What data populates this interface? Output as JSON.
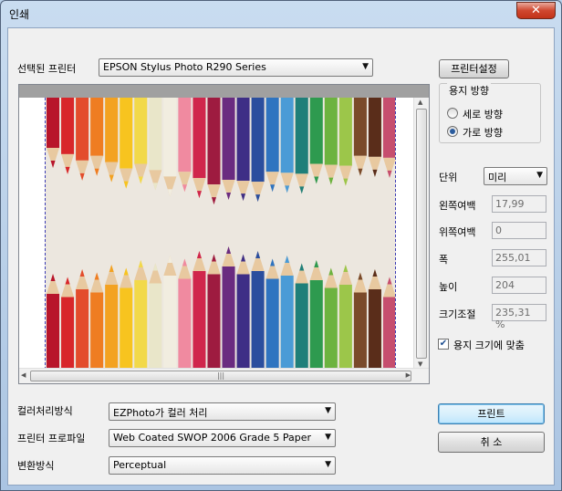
{
  "window": {
    "title": "인쇄",
    "close_glyph": "✕"
  },
  "printer": {
    "label": "선택된 프린터",
    "selected": "EPSON Stylus Photo R290 Series",
    "settings_button": "프린터설정"
  },
  "orientation": {
    "group_label": "용지 방향",
    "portrait": "세로 방향",
    "landscape": "가로 방향",
    "selected": "landscape"
  },
  "unit": {
    "label": "단위",
    "selected": "미리"
  },
  "margins": {
    "left_label": "왼쪽여백",
    "left_value": "17,99",
    "top_label": "위쪽여백",
    "top_value": "0",
    "width_label": "폭",
    "width_value": "255,01",
    "height_label": "높이",
    "height_value": "204",
    "scale_label": "크기조절",
    "scale_value": "235,31 %"
  },
  "fit_to_paper": {
    "label": "용지 크기에 맞춤",
    "checked": true
  },
  "color_handling": {
    "label": "컬러처리방식",
    "selected": "EZPhoto가 컬러 처리"
  },
  "printer_profile": {
    "label": "프린터 프로파일",
    "selected": "Web Coated SWOP 2006 Grade 5 Paper"
  },
  "rendering_intent": {
    "label": "변환방식",
    "selected": "Perceptual"
  },
  "buttons": {
    "print": "프린트",
    "cancel": "취 소"
  },
  "preview": {
    "scroll_grip": "|||"
  },
  "pencil_colors": [
    "#b8152b",
    "#d8262a",
    "#e34c2c",
    "#ef7d22",
    "#f3a221",
    "#f7c41f",
    "#f2d94a",
    "#e9e6c9",
    "#f1ede0",
    "#f08aa0",
    "#d0264c",
    "#9e1b40",
    "#6a2b80",
    "#3e2e86",
    "#2b4e9e",
    "#2f74c0",
    "#4a9bd6",
    "#1f7f79",
    "#2e9a4f",
    "#6cb33f",
    "#9cc64a",
    "#7a4a2a",
    "#5a2d1a",
    "#c64e6e"
  ]
}
